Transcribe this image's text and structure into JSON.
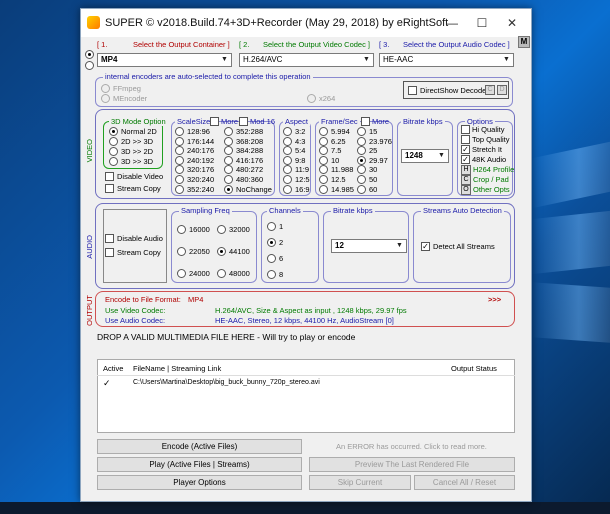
{
  "window": {
    "title": "SUPER © v2018.Build.74+3D+Recorder (May 29, 2018) by eRightSoft",
    "help_letter": "M"
  },
  "headers": {
    "container_num": "[ 1.",
    "container_label": "Select the Output Container ]",
    "video_num": "[ 2.",
    "video_label": "Select the Output Video Codec ]",
    "audio_num": "[ 3.",
    "audio_label": "Select the Output Audio Codec ]"
  },
  "selects": {
    "container": "MP4",
    "video_codec": "H.264/AVC",
    "audio_codec": "HE-AAC"
  },
  "encoders": {
    "notice": "internal encoders are auto-selected to complete this operation",
    "ffmpeg": "FFmpeg",
    "mencoder": "MEncoder",
    "x264": "x264",
    "directshow": "DirectShow Decode",
    "c_label": "C",
    "d_label": "D"
  },
  "video": {
    "section_label": "VIDEO",
    "mode3d_title": "3D Mode Option",
    "mode3d_options": [
      "Normal 2D",
      "2D >> 3D",
      "3D >> 2D",
      "3D >> 3D"
    ],
    "disable_video": "Disable Video",
    "stream_copy": "Stream Copy",
    "scalesize_title": "ScaleSize",
    "more_label": "More",
    "mod16_label": "Mod 16",
    "scale_col1": [
      "128:96",
      "176:144",
      "240:176",
      "240:192",
      "320:176",
      "320:240",
      "352:240"
    ],
    "scale_col2": [
      "352:288",
      "368:208",
      "384:288",
      "416:176",
      "480:272",
      "480:360",
      "NoChange"
    ],
    "aspect_title": "Aspect",
    "aspect_options": [
      "3:2",
      "4:3",
      "5:4",
      "9:8",
      "11:9",
      "12:5",
      "16:9"
    ],
    "fps_title": "Frame/Sec",
    "fps_more": "More",
    "fps_col1": [
      "5.994",
      "6.25",
      "7.5",
      "10",
      "11.988",
      "12.5",
      "14.985"
    ],
    "fps_col2": [
      "15",
      "23.976",
      "25",
      "29.97",
      "30",
      "50",
      "60"
    ],
    "bitrate_title": "Bitrate  kbps",
    "bitrate_value": "1248",
    "options_title": "Options",
    "options": [
      "Hi Quality",
      "Top Quality",
      "Stretch It",
      "48K Audio"
    ],
    "h264_profile_key": "H",
    "h264_profile": "H264 Profile",
    "crop_key": "C",
    "crop": "Crop / Pad",
    "other_key": "O",
    "other": "Other Opts"
  },
  "audio": {
    "section_label": "AUDIO",
    "disable_audio": "Disable Audio",
    "stream_copy": "Stream Copy",
    "freq_title": "Sampling Freq",
    "freq_options": [
      "16000",
      "32000",
      "22050",
      "44100",
      "24000",
      "48000"
    ],
    "channels_title": "Channels",
    "channels": [
      "1",
      "2",
      "6",
      "8"
    ],
    "bitrate_title": "Bitrate  kbps",
    "bitrate_value": "12",
    "streams_title": "Streams Auto Detection",
    "detect_all": "Detect All Streams"
  },
  "output": {
    "section_label": "OUTPUT",
    "format_label": "Encode to File Format:",
    "format_value": "MP4",
    "arrows": ">>>",
    "video_label": "Use Video Codec:",
    "video_value": "H.264/AVC,   Size & Aspect as input ,   1248 kbps,   29.97 fps",
    "audio_label": "Use Audio Codec:",
    "audio_value": "HE-AAC,   Stereo,   12 kbps,   44100 Hz,   AudioStream [0]"
  },
  "drop": {
    "text": "DROP A VALID MULTIMEDIA FILE HERE - Will try to play or encode"
  },
  "filelist": {
    "col_active": "Active",
    "col_filename": "FileName  |  Streaming Link",
    "col_status": "Output Status",
    "rows": [
      {
        "check": "✓",
        "path": "C:\\Users\\Martina\\Desktop\\big_buck_bunny_720p_stereo.avi"
      }
    ]
  },
  "buttons": {
    "encode": "Encode (Active Files)",
    "error": "An ERROR has occurred. Click to read more.",
    "play": "Play (Active Files | Streams)",
    "preview": "Preview The Last Rendered File",
    "player_options": "Player Options",
    "skip": "Skip Current",
    "cancel": "Cancel All   /   Reset"
  },
  "colors": {
    "desktop": "#0c5ab0",
    "red_text": "#b00000",
    "green_text": "#007a00",
    "blue_text": "#1a1aa8"
  }
}
